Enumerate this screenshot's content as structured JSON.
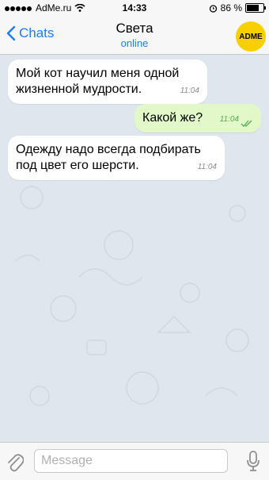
{
  "status_bar": {
    "carrier": "AdMe.ru",
    "time": "14:33",
    "battery_text": "86 %",
    "battery_level": 0.86
  },
  "nav": {
    "back_label": "Chats",
    "contact_name": "Света",
    "contact_status": "online",
    "avatar_text": "ADME"
  },
  "messages": [
    {
      "direction": "incoming",
      "text_lines": [
        "Мой кот научил меня одной",
        "жизненной мудрости."
      ],
      "time": "11:04"
    },
    {
      "direction": "outgoing",
      "text_lines": [
        "Какой же?"
      ],
      "time": "11:04",
      "read": true
    },
    {
      "direction": "incoming",
      "text_lines": [
        "Одежду надо всегда подбирать",
        "под цвет его шерсти."
      ],
      "time": "11:04"
    }
  ],
  "composer": {
    "placeholder": "Message"
  },
  "colors": {
    "accent": "#1a7df5",
    "outgoing_bubble": "#e2f8c9",
    "incoming_bubble": "#ffffff",
    "chat_background": "#dfe6ee",
    "avatar": "#f8d000"
  }
}
